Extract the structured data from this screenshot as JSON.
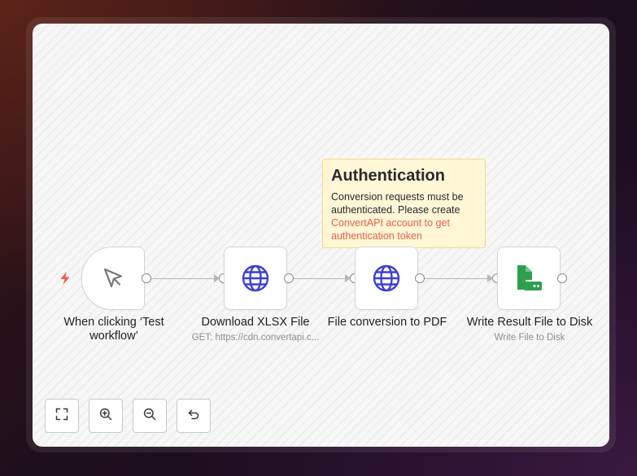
{
  "workflow": {
    "nodes": [
      {
        "id": "trigger",
        "title": "When clicking ‘Test workflow’",
        "subtitle": "",
        "icon": "cursor-icon"
      },
      {
        "id": "download",
        "title": "Download XLSX File",
        "subtitle": "GET: https://cdn.convertapi.c...",
        "icon": "globe-icon"
      },
      {
        "id": "convert",
        "title": "File conversion to PDF",
        "subtitle": "",
        "icon": "globe-icon"
      },
      {
        "id": "write",
        "title": "Write Result File to Disk",
        "subtitle": "Write File to Disk",
        "icon": "file-disk-icon"
      }
    ]
  },
  "sticky_note": {
    "title": "Authentication",
    "body_text": "Conversion requests must be authenticated. Please create ",
    "link_text": "ConvertAPI account to get authentication token"
  },
  "controls": [
    {
      "name": "fit-view-button",
      "icon": "fullscreen-icon"
    },
    {
      "name": "zoom-in-button",
      "icon": "zoom-in-icon"
    },
    {
      "name": "zoom-out-button",
      "icon": "zoom-out-icon"
    },
    {
      "name": "reset-zoom-button",
      "icon": "undo-icon"
    }
  ],
  "colors": {
    "globe": "#3b3fd6",
    "file_disk": "#2e9e4f",
    "trigger_bolt": "#f05a4f",
    "sticky_background": "#fff6d6",
    "sticky_link": "#e8604c"
  }
}
